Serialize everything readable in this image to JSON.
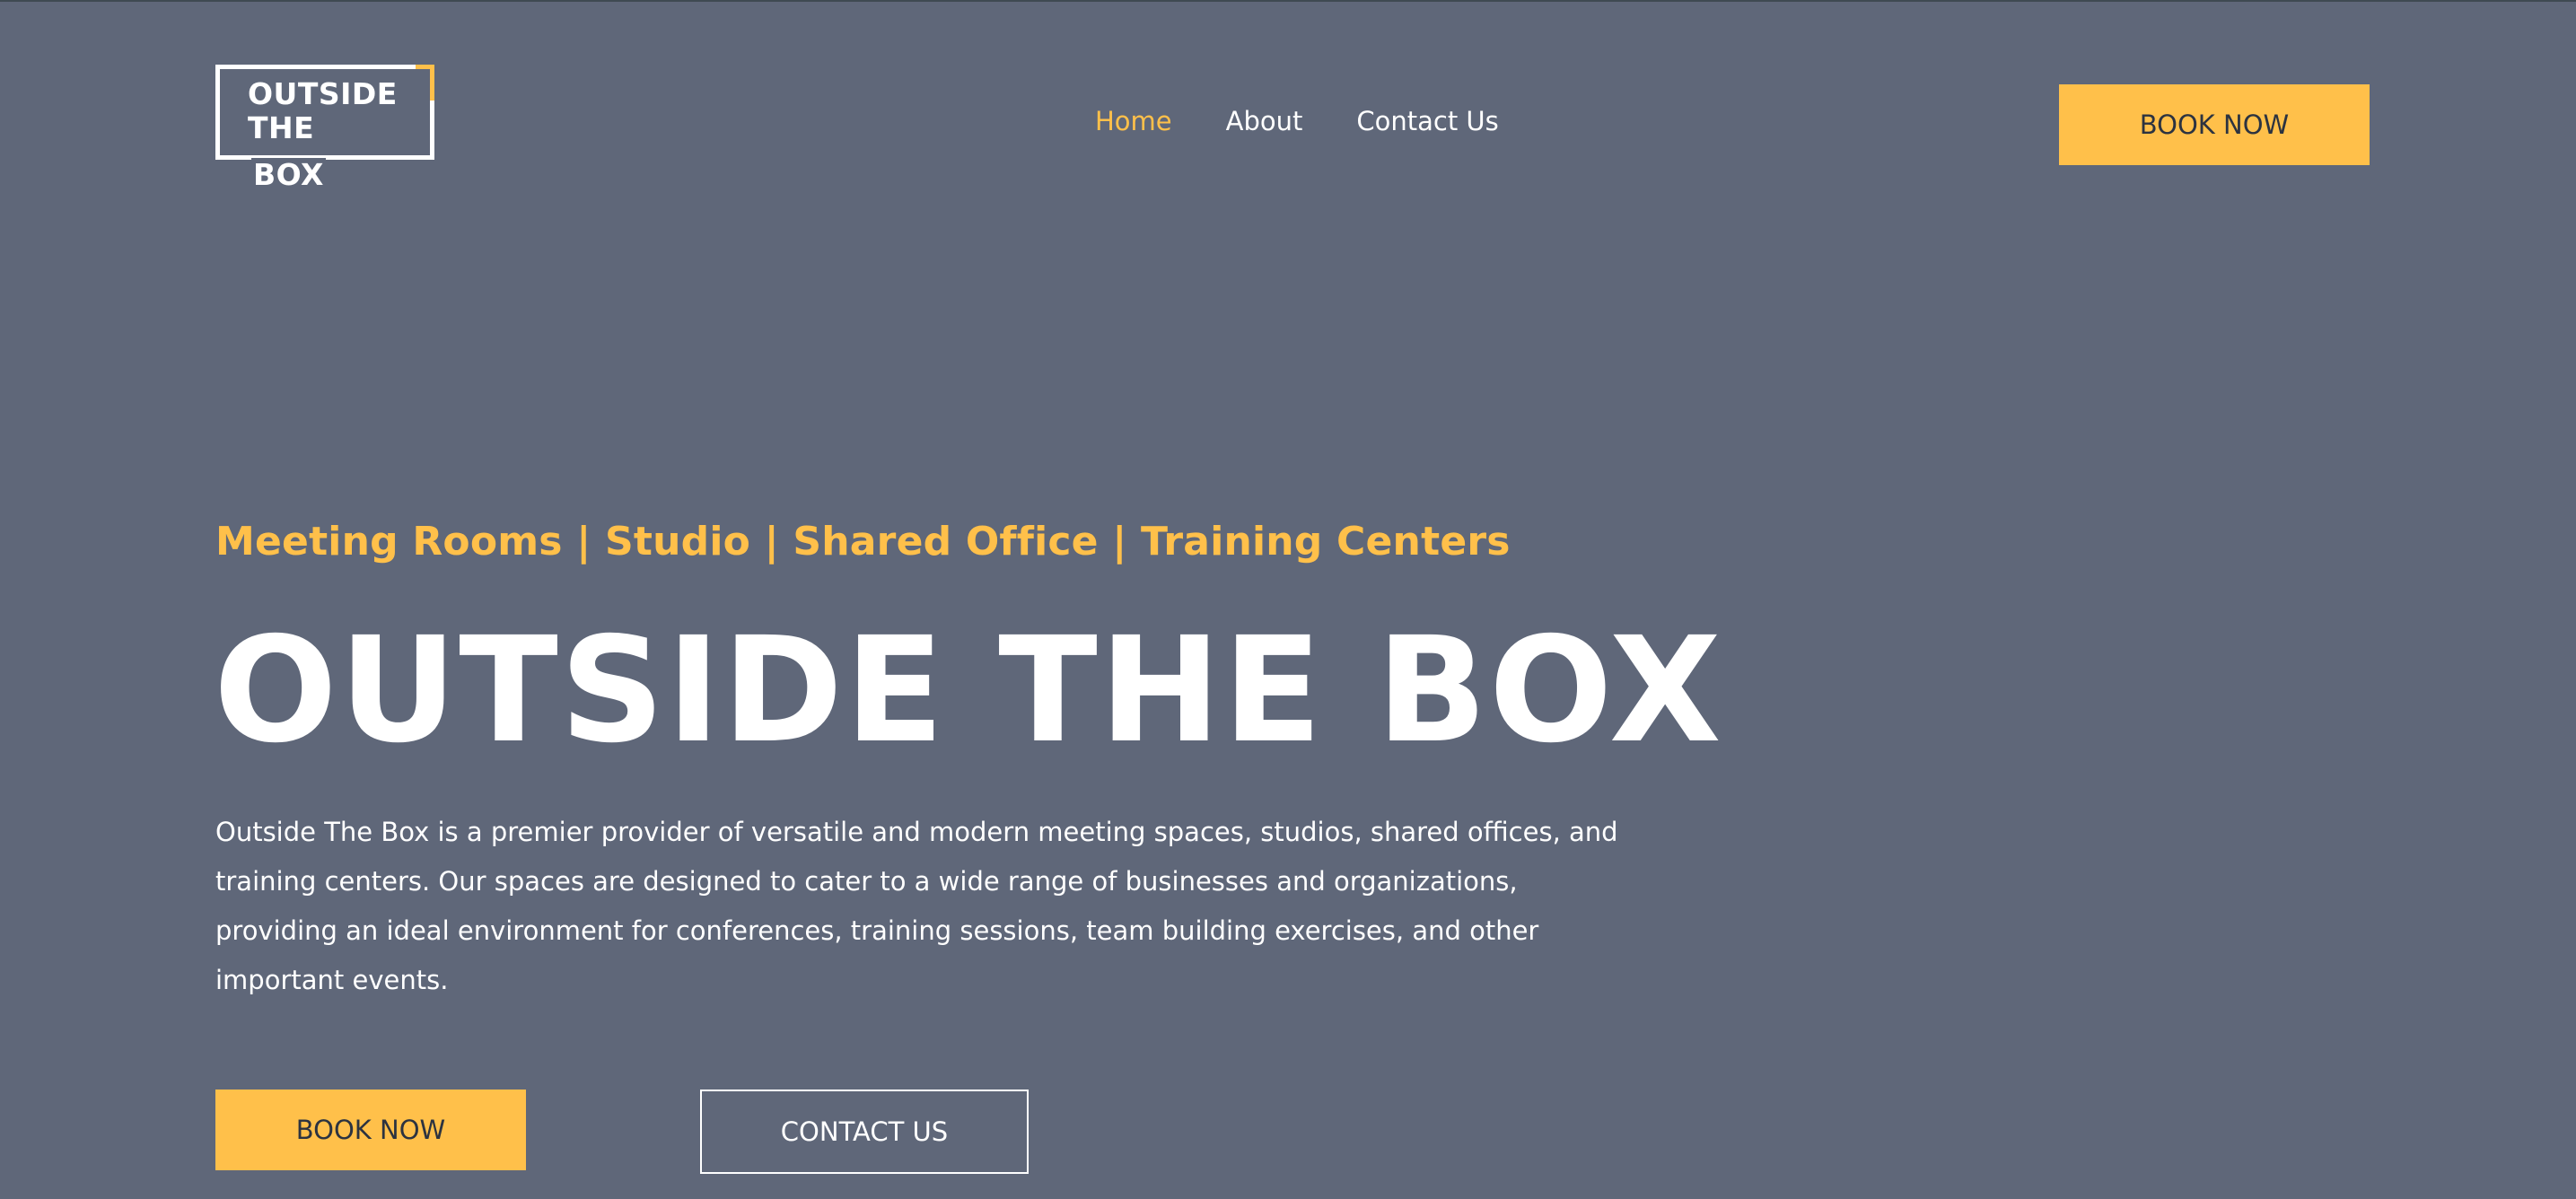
{
  "logo": {
    "line1": "OUTSIDE",
    "line2": "THE",
    "line3": "BOX"
  },
  "nav": {
    "items": [
      {
        "label": "Home",
        "active": true
      },
      {
        "label": "About",
        "active": false
      },
      {
        "label": "Contact Us",
        "active": false
      }
    ]
  },
  "header": {
    "cta_label": "BOOK NOW"
  },
  "hero": {
    "tagline": "Meeting Rooms | Studio | Shared Office | Training Centers",
    "title": "OUTSIDE THE BOX",
    "description": "Outside The Box is a premier provider of versatile and modern meeting spaces, studios, shared offices, and training centers. Our spaces are designed to cater to a wide range of businesses and organizations, providing an ideal environment for conferences, training sessions, team building exercises, and other important events.",
    "primary_button": "BOOK NOW",
    "secondary_button": "CONTACT US"
  },
  "colors": {
    "background": "#5f6779",
    "accent": "#ffc04a",
    "text": "#ffffff",
    "button_text": "#2c3340"
  }
}
